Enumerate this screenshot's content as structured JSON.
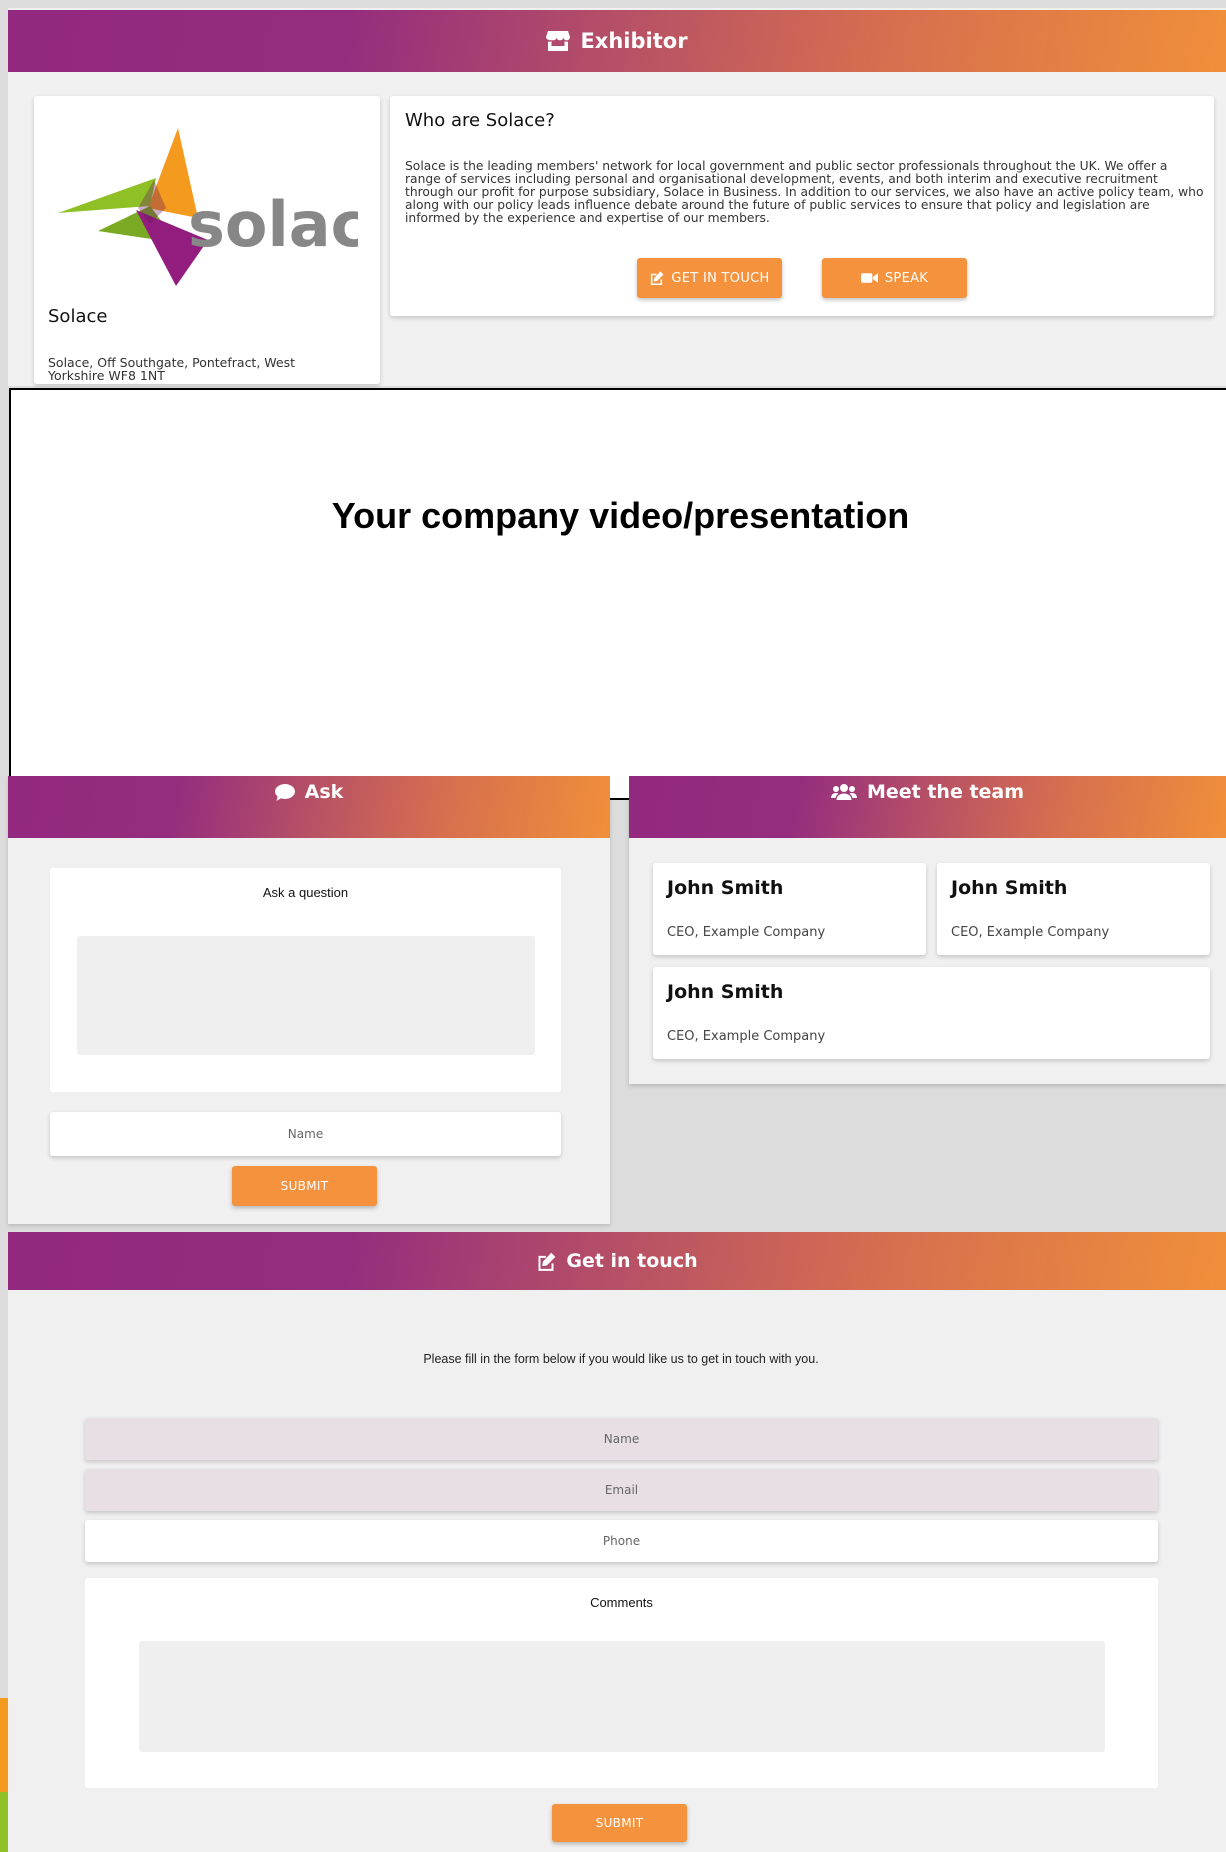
{
  "exhibitor": {
    "title": "Exhibitor",
    "company_name": "Solace",
    "logo_text": "solace",
    "address": "Solace, Off Southgate, Pontefract, West Yorkshire WF8 1NT",
    "about_title": "Who are Solace?",
    "about_text": "Solace is the leading members' network for local government and public sector professionals throughout the UK. We offer a range of services including personal and organisational development, events, and both interim and executive recruitment through our profit for purpose subsidiary, Solace in Business. In addition to our services, we also have an active policy team, who along with our policy leads influence debate around the future of public services to ensure that policy and legislation are informed by the experience and expertise of our members.",
    "get_in_touch_label": "GET IN TOUCH",
    "speak_label": "SPEAK"
  },
  "video": {
    "placeholder_text": "Your company video/presentation"
  },
  "ask": {
    "title": "Ask",
    "question_label": "Ask a question",
    "name_placeholder": "Name",
    "submit_label": "SUBMIT"
  },
  "team": {
    "title": "Meet the team",
    "members": [
      {
        "name": "John Smith",
        "role": "CEO, Example Company"
      },
      {
        "name": "John Smith",
        "role": "CEO, Example Company"
      },
      {
        "name": "John Smith",
        "role": "CEO, Example Company"
      }
    ]
  },
  "contact": {
    "title": "Get in touch",
    "intro": "Please fill in the form below if you would like us to get in touch with you.",
    "name_placeholder": "Name",
    "email_placeholder": "Email",
    "phone_placeholder": "Phone",
    "comments_label": "Comments",
    "submit_label": "SUBMIT"
  },
  "colors": {
    "gradient_start": "#93287f",
    "gradient_end": "#f08f3a",
    "button": "#f4923d",
    "highlight_field": "#e8dfe5"
  },
  "icons": {
    "exhibitor": "store-icon",
    "get_in_touch": "edit-icon",
    "speak": "video-camera-icon",
    "ask": "comment-icon",
    "team": "users-icon"
  }
}
